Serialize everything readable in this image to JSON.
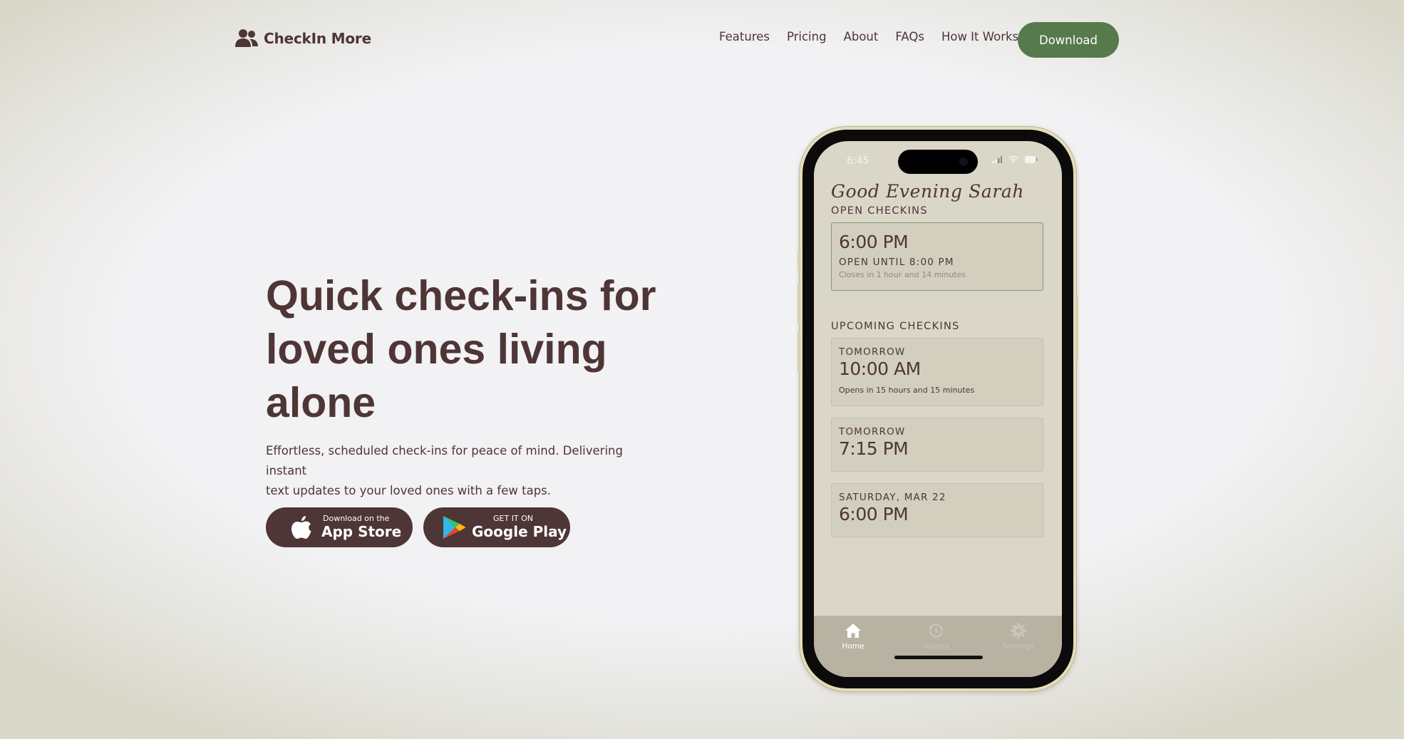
{
  "nav": {
    "brand": "CheckIn More",
    "brand_icon": "users-icon",
    "links": [
      "Features",
      "Pricing",
      "About",
      "FAQs",
      "How It Works"
    ],
    "cta": "Download",
    "cta_color": "#577a4c"
  },
  "hero": {
    "headline_lines": [
      "Quick check-ins for",
      "loved ones living",
      "alone"
    ],
    "subtitle_lines": [
      "Effortless, scheduled check-ins for peace of mind. Delivering instant",
      "text updates to your loved ones with a few taps."
    ],
    "app_store": {
      "small": "Download on the",
      "big": "App Store",
      "icon": "apple-icon"
    },
    "google_play": {
      "small": "GET IT ON",
      "big": "Google Play",
      "icon": "google-play-icon"
    },
    "text_color": "#4e3536"
  },
  "phone": {
    "status_time": "6:45",
    "greeting": "Good Evening Sarah",
    "open_title": "OPEN CHECKINS",
    "open_card": {
      "time": "6:00 PM",
      "until": "OPEN UNTIL 8:00 PM",
      "closes": "Closes in 1 hour and 14 minutes"
    },
    "upcoming_title": "UPCOMING CHECKINS",
    "upcoming": [
      {
        "day": "TOMORROW",
        "time": "10:00 AM",
        "note": "Opens in 15 hours and 15 minutes"
      },
      {
        "day": "TOMORROW",
        "time": "7:15 PM",
        "note": ""
      },
      {
        "day": "SATURDAY, MAR 22",
        "time": "6:00 PM",
        "note": ""
      }
    ],
    "tabs": [
      {
        "label": "Home",
        "icon": "home-icon",
        "active": true
      },
      {
        "label": "History",
        "icon": "history-icon",
        "active": false
      },
      {
        "label": "Settings",
        "icon": "gear-icon",
        "active": false
      }
    ]
  }
}
